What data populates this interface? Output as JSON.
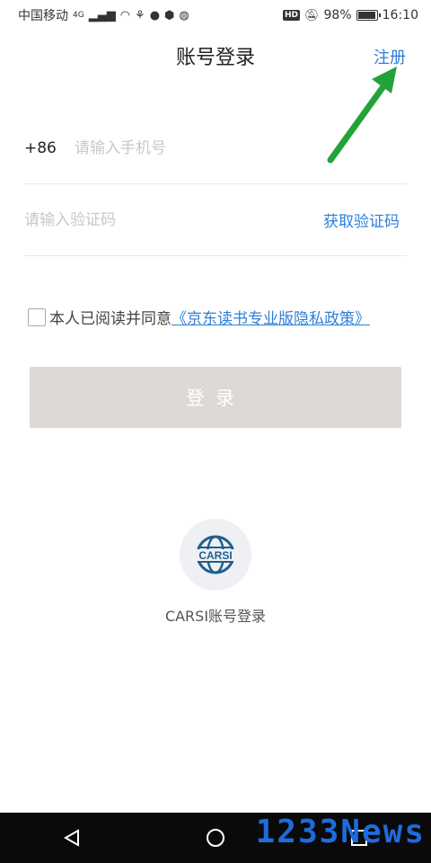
{
  "status_bar": {
    "carrier": "中国移动",
    "network": "4G",
    "battery": "98%",
    "battery_level": 0.98,
    "time": "16:10",
    "hd_badge": "HD"
  },
  "header": {
    "title": "账号登录",
    "register_label": "注册"
  },
  "phone_row": {
    "prefix": "+86",
    "placeholder": "请输入手机号"
  },
  "code_row": {
    "placeholder": "请输入验证码",
    "get_code_label": "获取验证码"
  },
  "agreement": {
    "text": "本人已阅读并同意",
    "policy_link": "《京东读书专业版隐私政策》"
  },
  "login_button": {
    "label": "登录"
  },
  "carsi": {
    "logo_text": "CARSI",
    "label": "CARSI账号登录"
  },
  "watermark": {
    "text": "1233News"
  },
  "colors": {
    "accent": "#2f7fd8",
    "button_disabled": "#ddd9d4",
    "arrow": "#22a33a",
    "carsi_blue": "#1f5f8b"
  }
}
